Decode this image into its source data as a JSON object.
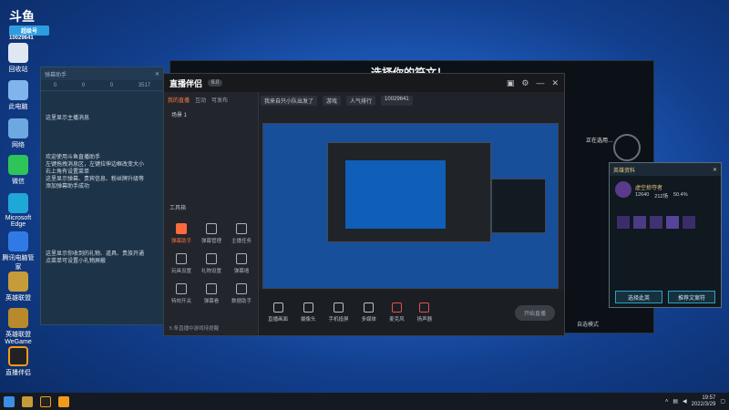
{
  "brand": {
    "name": "斗鱼",
    "badge": "超级号",
    "id": "10029641"
  },
  "desktop_icons": [
    {
      "label": "回收站"
    },
    {
      "label": "此电脑"
    },
    {
      "label": "网络"
    },
    {
      "label": "微信"
    },
    {
      "label": "Microsoft Edge"
    },
    {
      "label": "腾讯电脑管家"
    },
    {
      "label": "英雄联盟"
    },
    {
      "label": "英雄联盟WeGame"
    },
    {
      "label": "直播伴侣"
    }
  ],
  "assistant": {
    "title": "弹幕助手",
    "stats": [
      "0",
      "0",
      "0",
      "0",
      "3517"
    ],
    "lines": [
      "这里显示主播消息",
      "欢迎使用斗鱼直播助手",
      "左键拖拽消息区，左键拉伸边框改变大小",
      "右上角有设置菜单",
      "这里显示弹幕、贵宾信息、粉丝牌升级等",
      "添加弹幕助手成功",
      "这里显示你收到的礼物、道具、贵族开通",
      "点菜单可设置小礼物屏蔽"
    ]
  },
  "game": {
    "title": "选择你的符文！",
    "status_label": "正在选用…",
    "mode": "自选模式"
  },
  "app": {
    "name": "直播伴侣",
    "version": "6.0",
    "tabs": [
      "我的直播",
      "互动",
      "可发布"
    ],
    "scene": "场景 1",
    "stream_title": "我来自只小队出发了",
    "category": "游戏",
    "tag": "人气排行",
    "room_id": "10029641",
    "tools_label": "工具箱",
    "tools": [
      {
        "label": "弹幕助手",
        "hot": true
      },
      {
        "label": "弹幕管理",
        "hot": false
      },
      {
        "label": "主播任务",
        "hot": false
      },
      {
        "label": "玩具设置",
        "hot": false
      },
      {
        "label": "礼物设置",
        "hot": false
      },
      {
        "label": "弹幕墙",
        "hot": false
      },
      {
        "label": "特效开关",
        "hot": false
      },
      {
        "label": "弹幕看",
        "hot": false
      },
      {
        "label": "数据助手",
        "hot": false
      }
    ],
    "bottom": [
      "直播画面",
      "摄像头",
      "手机投屏",
      "多媒体",
      "麦克风",
      "扬声器"
    ],
    "start_btn": "开始直播",
    "footer_note": "5 条直播中游戏待提醒"
  },
  "champ": {
    "title": "英雄资料",
    "name": "虚空掠夺者",
    "stats": [
      "12640",
      "212场",
      "50.4%"
    ],
    "btn_left": "选择此英",
    "btn_right": "推荐文案符"
  },
  "taskbar": {
    "time": "19:57",
    "date": "2022/3/29"
  }
}
